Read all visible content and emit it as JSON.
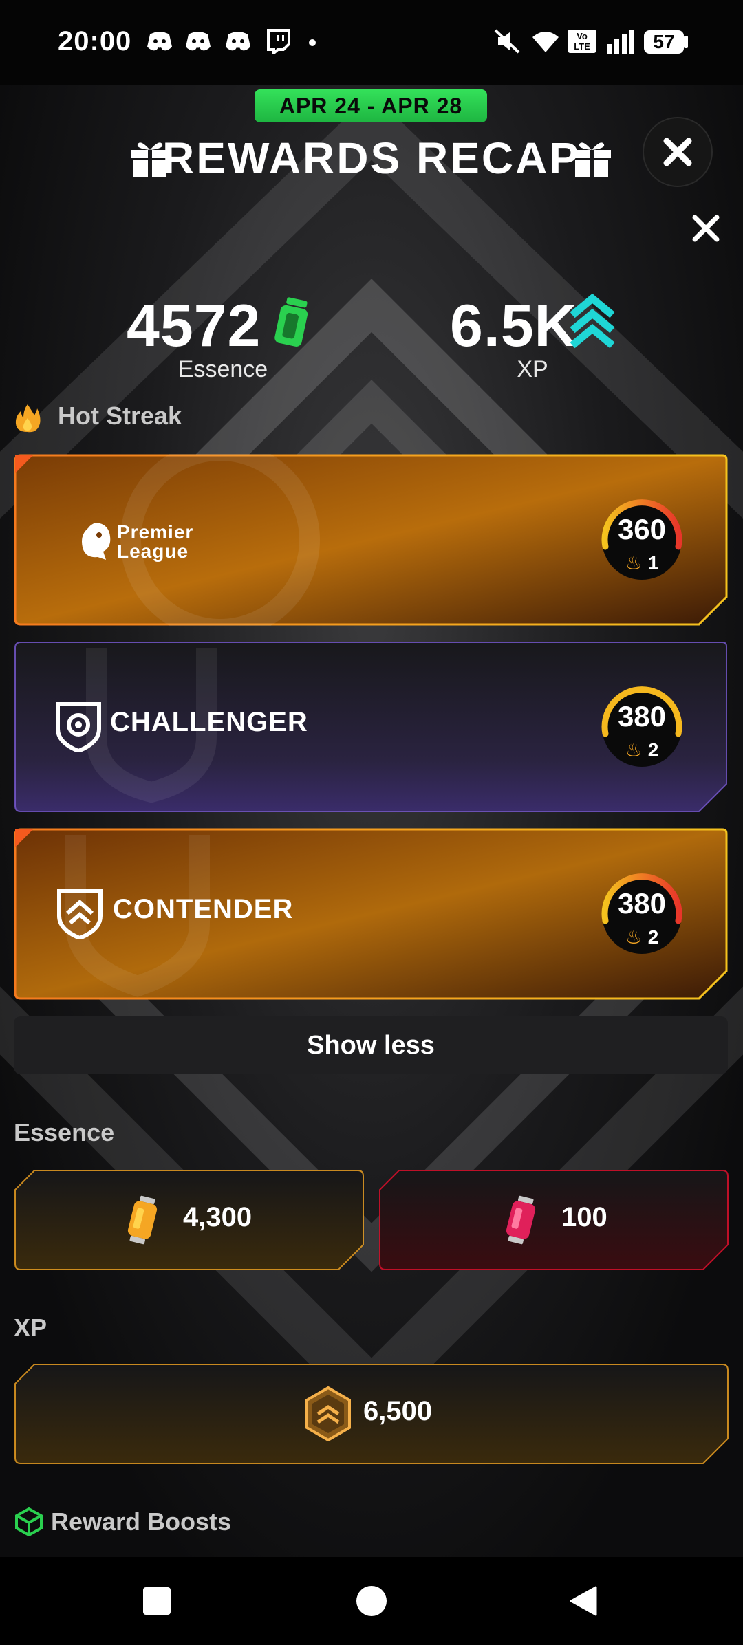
{
  "status_bar": {
    "time": "20:00",
    "battery": "57",
    "icons": [
      "discord-icon",
      "discord-icon",
      "discord-icon",
      "twitch-icon",
      "dot-icon",
      "mute-icon",
      "wifi-icon",
      "volte-icon",
      "signal-icon",
      "battery-icon"
    ]
  },
  "header": {
    "date_range": "APR 24 - APR 28",
    "title": "REWARDS RECAP"
  },
  "summary": {
    "essence_value": "4572",
    "essence_label": "Essence",
    "xp_value": "6.5K",
    "xp_label": "XP"
  },
  "hot_streak": {
    "label": "Hot Streak",
    "cards": [
      {
        "name": "Premier League",
        "line1": "Premier",
        "line2": "League",
        "points": "360",
        "streak": "1",
        "style": "orange"
      },
      {
        "name": "CHALLENGER",
        "points": "380",
        "streak": "2",
        "style": "purple"
      },
      {
        "name": "CONTENDER",
        "points": "380",
        "streak": "2",
        "style": "orange"
      }
    ],
    "show_less": "Show less"
  },
  "essence_section": {
    "label": "Essence",
    "items": [
      {
        "value": "4,300",
        "color": "#f5a623"
      },
      {
        "value": "100",
        "color": "#d0102a"
      }
    ]
  },
  "xp_section": {
    "label": "XP",
    "value": "6,500"
  },
  "reward_boosts": {
    "label": "Reward Boosts"
  },
  "colors": {
    "accent_green": "#2ad04f",
    "accent_cyan": "#1fd6d6",
    "orange": "#f5a623",
    "purple": "#7a5bd6"
  }
}
